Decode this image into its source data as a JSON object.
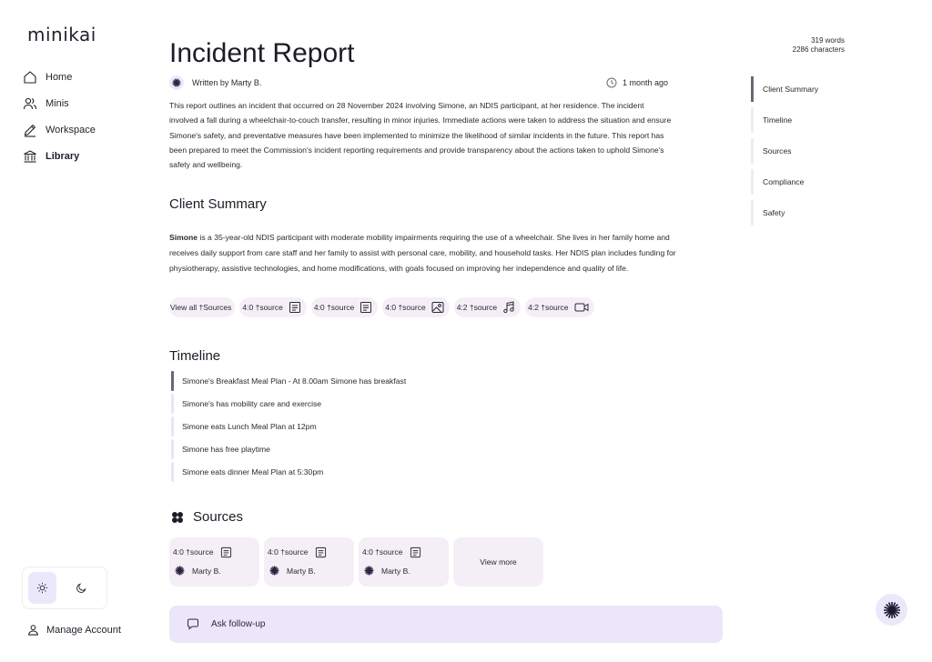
{
  "app": {
    "logo": "minikai"
  },
  "sidebar": {
    "items": [
      {
        "label": "Home",
        "icon": "home-icon"
      },
      {
        "label": "Minis",
        "icon": "users-icon"
      },
      {
        "label": "Workspace",
        "icon": "pencil-icon"
      },
      {
        "label": "Library",
        "icon": "library-icon",
        "active": true
      }
    ],
    "theme": {
      "options": [
        "light",
        "dark"
      ],
      "selected": "light"
    },
    "manage_account": "Manage Account"
  },
  "document": {
    "title": "Incident Report",
    "author": "Written by Marty B.",
    "time": "1 month ago",
    "intro": "This report outlines an incident that occurred on 28 November 2024 involving Simone, an NDIS participant, at her residence. The incident involved a fall during a wheelchair-to-couch transfer, resulting in minor injuries. Immediate actions were taken to address the situation and ensure Simone's safety, and preventative measures have been implemented to minimize the likelihood of similar incidents in the future. This report has been prepared to meet the Commission's incident reporting requirements and provide transparency about the actions taken to uphold Simone's safety and wellbeing.",
    "client_summary": {
      "heading": "Client Summary",
      "name": "Simone",
      "text": " is a 35-year-old NDIS participant with moderate mobility impairments requiring the use of a wheelchair. She lives in her family home and receives daily support from care staff and her family to assist with personal care, mobility, and household tasks. Her NDIS plan includes funding for physiotherapy, assistive technologies, and home modifications, with goals focused on improving her independence and quality of life.",
      "view_all": "View all †Sources",
      "chips": [
        {
          "label": "4:0 †source",
          "icon": "document-icon"
        },
        {
          "label": "4:0 †source",
          "icon": "document-icon"
        },
        {
          "label": "4:0 †source",
          "icon": "image-icon"
        },
        {
          "label": "4:2 †source",
          "icon": "music-icon"
        },
        {
          "label": "4:2 †source",
          "icon": "video-icon"
        }
      ]
    },
    "timeline": {
      "heading": "Timeline",
      "items": [
        "Simone's Breakfast Meal Plan - At 8.00am Simone has breakfast",
        "Simone's has mobility care and exercise",
        "Simone eats Lunch Meal Plan at 12pm",
        "Simone has free playtime",
        "Simone eats dinner Meal Plan at 5:30pm"
      ]
    },
    "sources": {
      "heading": "Sources",
      "cards": [
        {
          "label": "4:0 †source",
          "author": "Marty B."
        },
        {
          "label": "4:0 †source",
          "author": "Marty B."
        },
        {
          "label": "4:0 †source",
          "author": "Marty B."
        }
      ],
      "view_more": "View more"
    }
  },
  "ask": {
    "label": "Ask follow-up"
  },
  "stats": {
    "words": "319 words",
    "characters": "2286 characters"
  },
  "toc": {
    "items": [
      "Client Summary",
      "Timeline",
      "Sources",
      "Compliance",
      "Safety"
    ],
    "active": "Client Summary"
  },
  "colors": {
    "accent": "#ece6fa",
    "chip": "#f4eef6",
    "indicator": "#6b6776"
  }
}
